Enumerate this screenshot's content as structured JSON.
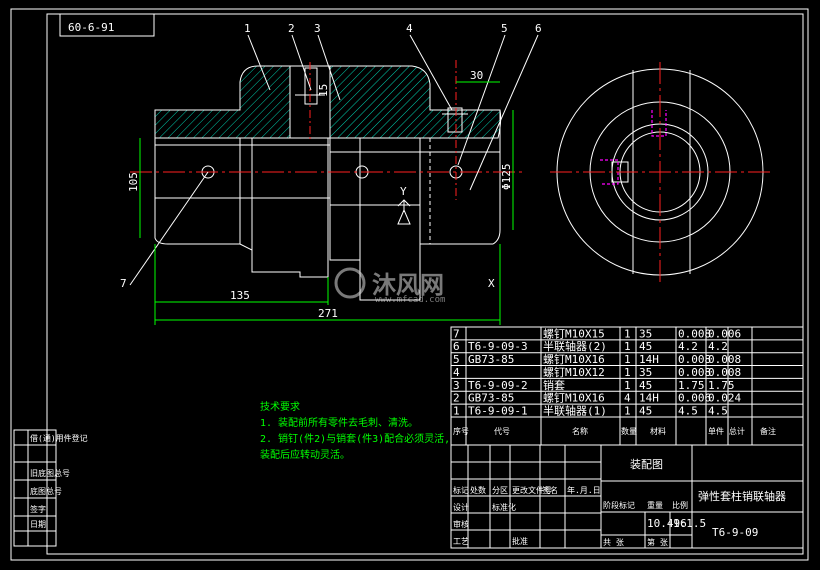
{
  "drawing": {
    "title_box": "60-6-91",
    "balloons": [
      "1",
      "2",
      "3",
      "4",
      "5",
      "6",
      "7"
    ],
    "dims": {
      "d135": "135",
      "d271": "271",
      "d30": "30",
      "d105": "105",
      "d125": "Φ125",
      "d15": "15"
    },
    "notes_title": "技术要求",
    "notes": [
      "1. 装配前所有零件去毛刺、清洗。",
      "2. 销钉(件2)与销套(件3)配合必须灵活,",
      "   装配后应转动灵活。"
    ],
    "watermark": {
      "brand": "沐风网",
      "url": "www.mfcad.com"
    },
    "view_labels": [
      "Y",
      "X"
    ]
  },
  "bom": {
    "rows": [
      {
        "no": "7",
        "code": "",
        "name": "螺钉M10X15",
        "qty": "1",
        "mat": "35",
        "w1": "0.008",
        "w2": "0.006"
      },
      {
        "no": "6",
        "code": "T6-9-09-3",
        "name": "半联轴器(2)",
        "qty": "1",
        "mat": "45",
        "w1": "4.2",
        "w2": "4.2"
      },
      {
        "no": "5",
        "code": "GB73-85",
        "name": "螺钉M10X16",
        "qty": "1",
        "mat": "14H",
        "w1": "0.008",
        "w2": "0.008"
      },
      {
        "no": "4",
        "code": "",
        "name": "螺钉M10X12",
        "qty": "1",
        "mat": "35",
        "w1": "0.008",
        "w2": "0.008"
      },
      {
        "no": "3",
        "code": "T6-9-09-2",
        "name": "销套",
        "qty": "1",
        "mat": "45",
        "w1": "1.75",
        "w2": "1.75"
      },
      {
        "no": "2",
        "code": "GB73-85",
        "name": "螺钉M10X16",
        "qty": "4",
        "mat": "14H",
        "w1": "0.006",
        "w2": "0.024"
      },
      {
        "no": "1",
        "code": "T6-9-09-1",
        "name": "半联轴器(1)",
        "qty": "1",
        "mat": "45",
        "w1": "4.5",
        "w2": "4.5"
      }
    ],
    "header": {
      "no": "序号",
      "code": "代号",
      "name": "名称",
      "qty": "数量",
      "mat": "材料",
      "w": "单件 总计",
      "remark": "备注"
    }
  },
  "title_block": {
    "drawing_name": "装配图",
    "part_name": "弹性套柱销联轴器",
    "drawing_no": "T6-9-09",
    "weight": "10.496",
    "scale": "1:1.5",
    "labels": [
      "标记",
      "处数",
      "分区",
      "更改文件号",
      "签名",
      "年.月.日",
      "设计",
      "标准化",
      "审核",
      "工艺",
      "批准",
      "阶段标记",
      "重量",
      "比例",
      "共 张",
      "第 张"
    ]
  },
  "side_block": {
    "labels": [
      "借(通)用件登记",
      "旧底图总号",
      "底图总号",
      "签字",
      "日期"
    ]
  }
}
